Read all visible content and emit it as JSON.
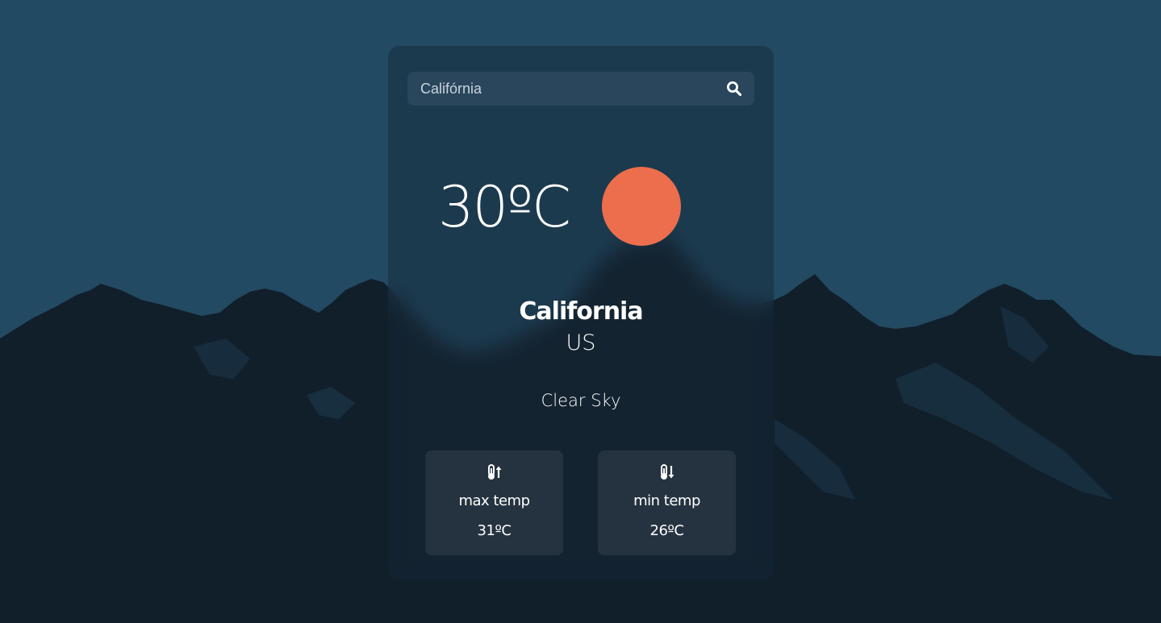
{
  "search": {
    "value": "Califórnia",
    "icon": "search-icon"
  },
  "weather": {
    "temperature": "30ºC",
    "icon": "sun-icon",
    "city": "California",
    "country": "US",
    "condition": "Clear Sky"
  },
  "stats": [
    {
      "icon": "thermometer-up-icon",
      "label": "max temp",
      "value": "31ºC"
    },
    {
      "icon": "thermometer-down-icon",
      "label": "min temp",
      "value": "26ºC"
    }
  ],
  "colors": {
    "sky": "#224a62",
    "mountains": "#111f2b",
    "sun": "#ec6e4c"
  }
}
